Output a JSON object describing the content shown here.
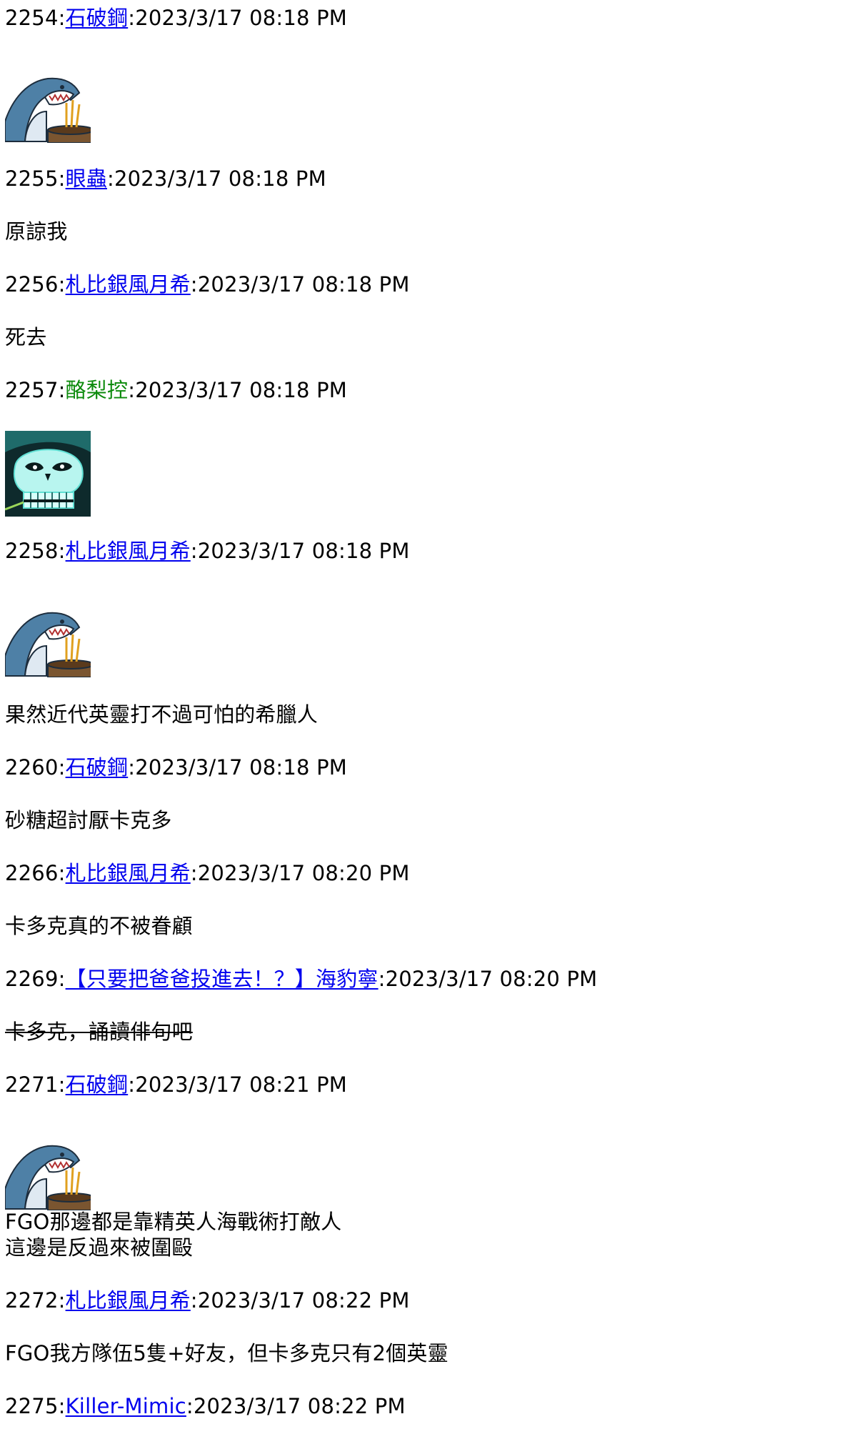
{
  "posts": [
    {
      "num": "2254",
      "user": "石破鋼",
      "time": "2023/3/17 08:18 PM"
    },
    {
      "num": "2255",
      "user": "眼蟲",
      "time": "2023/3/17 08:18 PM",
      "text": "原諒我"
    },
    {
      "num": "2256",
      "user": "札比銀風月希",
      "time": "2023/3/17 08:18 PM",
      "text": "死去"
    },
    {
      "num": "2257",
      "user": "酪梨控",
      "time": "2023/3/17 08:18 PM"
    },
    {
      "num": "2258",
      "user": "札比銀風月希",
      "time": "2023/3/17 08:18 PM",
      "text": "果然近代英靈打不過可怕的希臘人"
    },
    {
      "num": "2260",
      "user": "石破鋼",
      "time": "2023/3/17 08:18 PM",
      "text": "砂糖超討厭卡克多"
    },
    {
      "num": "2266",
      "user": "札比銀風月希",
      "time": "2023/3/17 08:20 PM",
      "text": "卡多克真的不被眷顧"
    },
    {
      "num": "2269",
      "user": "【只要把爸爸投進去！？】海豹寧",
      "time": "2023/3/17 08:20 PM",
      "text": "卡多克，誦讀俳句吧"
    },
    {
      "num": "2271",
      "user": "石破鋼",
      "time": "2023/3/17 08:21 PM",
      "text_line1": "FGO那邊都是靠精英人海戰術打敵人",
      "text_line2": "這邊是反過來被圍毆"
    },
    {
      "num": "2272",
      "user": "札比銀風月希",
      "time": "2023/3/17 08:22 PM",
      "text": "FGO我方隊伍5隻+好友，但卡多克只有2個英靈"
    },
    {
      "num": "2275",
      "user": "Killer-Mimic",
      "time": "2023/3/17 08:22 PM"
    }
  ],
  "colors": {
    "link": "#0000ee",
    "green_user": "#0b8a0b"
  },
  "icons": {
    "shark_sticker": "shark-with-incense-sticker",
    "skull_sticker": "glowing-skull-sticker"
  }
}
